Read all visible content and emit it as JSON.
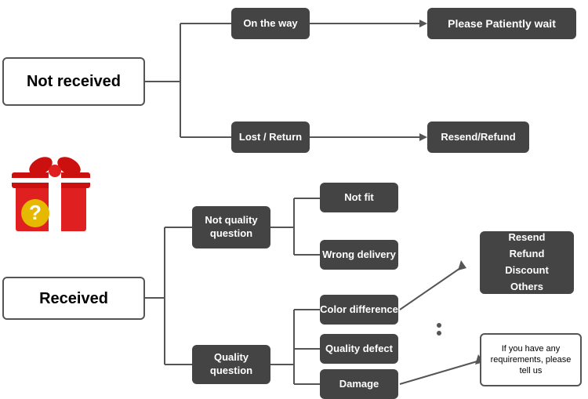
{
  "nodes": {
    "not_received": {
      "label": "Not received"
    },
    "on_the_way": {
      "label": "On the way"
    },
    "please_wait": {
      "label": "Please Patiently wait"
    },
    "lost_return": {
      "label": "Lost / Return"
    },
    "resend_refund_top": {
      "label": "Resend/Refund"
    },
    "received": {
      "label": "Received"
    },
    "not_quality": {
      "label": "Not quality question"
    },
    "quality_q": {
      "label": "Quality question"
    },
    "not_fit": {
      "label": "Not fit"
    },
    "wrong_delivery": {
      "label": "Wrong delivery"
    },
    "color_diff": {
      "label": "Color difference"
    },
    "quality_defect": {
      "label": "Quality defect"
    },
    "damage": {
      "label": "Damage"
    },
    "resend_options": {
      "label": "Resend\nRefund\nDiscount\nOthers"
    },
    "requirements": {
      "label": "If you have any requirements, please tell us"
    }
  }
}
